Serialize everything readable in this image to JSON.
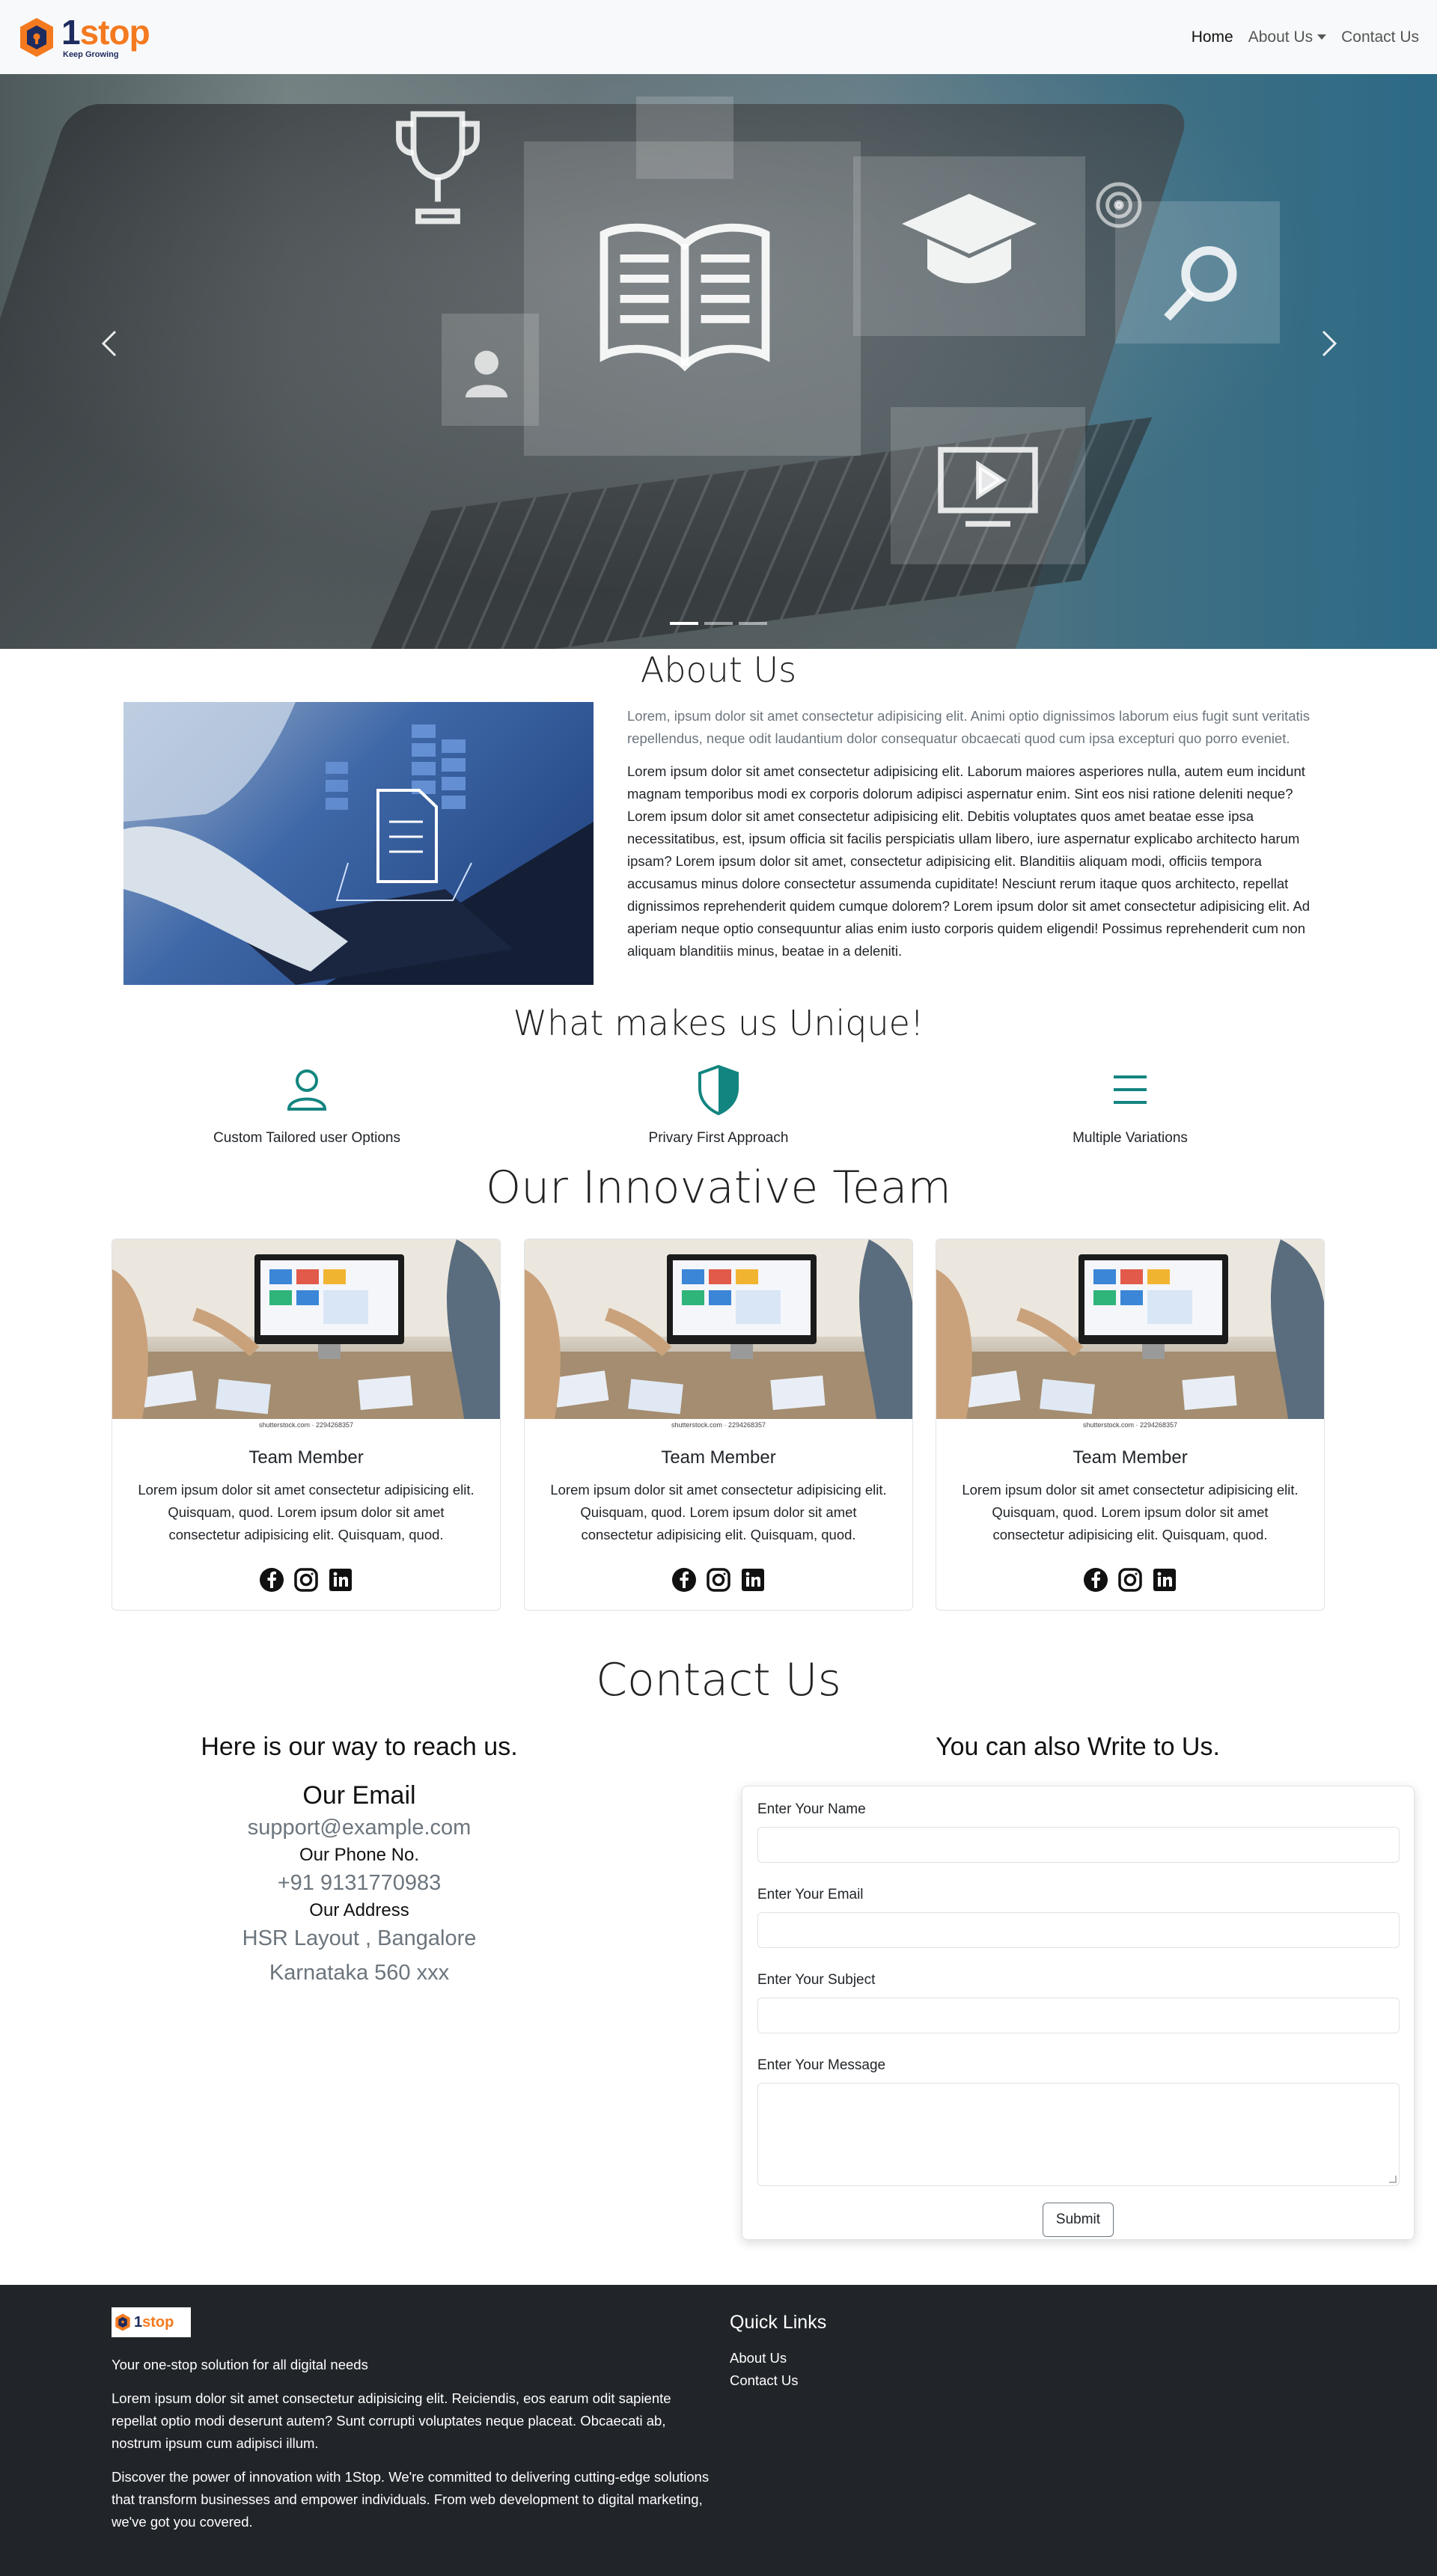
{
  "navbar": {
    "brand": {
      "name_prefix": "1",
      "name_suffix": "stop",
      "tagline": "Keep Growing"
    },
    "links": [
      {
        "label": "Home",
        "active": true
      },
      {
        "label": "About Us",
        "dropdown": true
      },
      {
        "label": "Contact Us"
      }
    ]
  },
  "carousel": {
    "slides": 3,
    "active_slide": 1,
    "icons": [
      "trophy-icon",
      "book-icon",
      "graduation-cap-icon",
      "magnifier-icon",
      "user-icon",
      "video-icon",
      "target-icon"
    ]
  },
  "about": {
    "title": "About Us",
    "lead": "Lorem, ipsum dolor sit amet consectetur adipisicing elit. Animi optio dignissimos laborum eius fugit sunt veritatis repellendus, neque odit laudantium dolor consequatur obcaecati quod cum ipsa excepturi quo porro eveniet.",
    "body": "Lorem ipsum dolor sit amet consectetur adipisicing elit. Laborum maiores asperiores nulla, autem eum incidunt magnam temporibus modi ex corporis dolorum adipisci aspernatur enim. Sint eos nisi ratione deleniti neque? Lorem ipsum dolor sit amet consectetur adipisicing elit. Debitis voluptates quos amet beatae esse ipsa necessitatibus, est, ipsum officia sit facilis perspiciatis ullam libero, iure aspernatur explicabo architecto harum ipsam? Lorem ipsum dolor sit amet, consectetur adipisicing elit. Blanditiis aliquam modi, officiis tempora accusamus minus dolore consectetur assumenda cupiditate! Nesciunt rerum itaque quos architecto, repellat dignissimos reprehenderit quidem cumque dolorem? Lorem ipsum dolor sit amet consectetur adipisicing elit. Ad aperiam neque optio consequuntur alias enim iusto corporis quidem eligendi! Possimus reprehenderit cum non aliquam blanditiis minus, beatae in a deleniti."
  },
  "unique": {
    "title": "What makes us Unique!",
    "features": [
      {
        "label": "Custom Tailored user Options",
        "icon": "person-icon"
      },
      {
        "label": "Privary First Approach",
        "icon": "shield-icon"
      },
      {
        "label": "Multiple Variations",
        "icon": "menu-icon"
      }
    ]
  },
  "team": {
    "title": "Our Innovative Team",
    "image_caption": "shutterstock.com · 2294268357",
    "members": [
      {
        "name": "Team Member",
        "text": "Lorem ipsum dolor sit amet consectetur adipisicing elit. Quisquam, quod. Lorem ipsum dolor sit amet consectetur adipisicing elit. Quisquam, quod."
      },
      {
        "name": "Team Member",
        "text": "Lorem ipsum dolor sit amet consectetur adipisicing elit. Quisquam, quod. Lorem ipsum dolor sit amet consectetur adipisicing elit. Quisquam, quod."
      },
      {
        "name": "Team Member",
        "text": "Lorem ipsum dolor sit amet consectetur adipisicing elit. Quisquam, quod. Lorem ipsum dolor sit amet consectetur adipisicing elit. Quisquam, quod."
      }
    ],
    "social_icons": [
      "facebook-icon",
      "instagram-icon",
      "linkedin-icon"
    ]
  },
  "contact": {
    "title": "Contact Us",
    "reach_heading": "Here is our way to reach us.",
    "email_title": "Our Email",
    "email": "support@example.com",
    "phone_title": "Our Phone No.",
    "phone": "+91 9131770983",
    "address_title": "Our Address",
    "address_line1": "HSR Layout , Bangalore",
    "address_line2": "Karnataka 560 xxx",
    "write_heading": "You can also Write to Us.",
    "form": {
      "name_label": "Enter Your Name",
      "email_label": "Enter Your Email",
      "subject_label": "Enter Your Subject",
      "message_label": "Enter Your Message",
      "submit_label": "Submit"
    }
  },
  "footer": {
    "logo": {
      "name_prefix": "1",
      "name_suffix": "stop"
    },
    "tagline": "Your one-stop solution for all digital needs",
    "para1": "Lorem ipsum dolor sit amet consectetur adipisicing elit. Reiciendis, eos earum odit sapiente repellat optio modi deserunt autem? Sunt corrupti voluptates neque placeat. Obcaecati ab, nostrum ipsum cum adipisci illum.",
    "para2": "Discover the power of innovation with 1Stop. We're committed to delivering cutting-edge solutions that transform businesses and empower individuals. From web development to digital marketing, we've got you covered.",
    "quick_links_title": "Quick Links",
    "quick_links": [
      "About Us",
      "Contact Us"
    ]
  },
  "colors": {
    "brand_orange": "#f47a20",
    "brand_navy": "#1d2b5f",
    "accent_teal": "#138580",
    "footer_bg": "#212529",
    "navbar_bg": "#f8f9fa"
  }
}
